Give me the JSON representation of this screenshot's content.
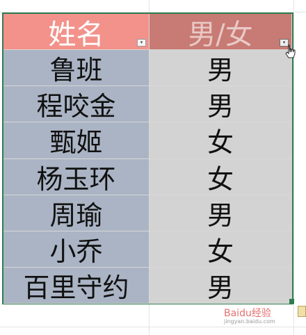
{
  "table": {
    "headers": {
      "name": "姓名",
      "gender": "男/女"
    },
    "rows": [
      {
        "name": "鲁班",
        "gender": "男"
      },
      {
        "name": "程咬金",
        "gender": "男"
      },
      {
        "name": "甄姬",
        "gender": "女"
      },
      {
        "name": "杨玉环",
        "gender": "女"
      },
      {
        "name": "周瑜",
        "gender": "男"
      },
      {
        "name": "小乔",
        "gender": "女"
      },
      {
        "name": "百里守约",
        "gender": "男"
      }
    ]
  },
  "filter": {
    "dropdown_glyph": "▾"
  },
  "watermark": {
    "text": "Baidu经验",
    "sub": "jingyan.baidu.com"
  },
  "colors": {
    "header_name_bg": "#f2928a",
    "header_gender_bg": "#c87a74",
    "row_name_bg": "#aab4c4",
    "row_gender_bg": "#d3d3d3",
    "selection_border": "#2e7d4f"
  },
  "icons": [
    "filter-dropdown-icon",
    "mouse-pointer-icon",
    "paste-options-icon",
    "resize-handle-icon"
  ]
}
